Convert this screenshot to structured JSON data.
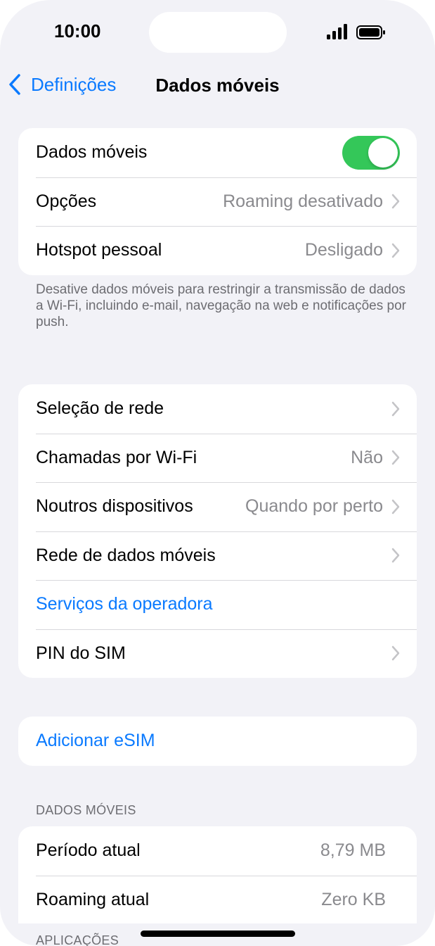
{
  "status_bar": {
    "time": "10:00"
  },
  "nav": {
    "back_label": "Definições",
    "title": "Dados móveis"
  },
  "group1": {
    "mobile_data_label": "Dados móveis",
    "mobile_data_on": true,
    "options_label": "Opções",
    "options_value": "Roaming desativado",
    "hotspot_label": "Hotspot pessoal",
    "hotspot_value": "Desligado"
  },
  "footnote": "Desative dados móveis para restringir a transmissão de dados a Wi-Fi, incluindo e-mail, navegação na web e notificações por push.",
  "group2": {
    "network_selection_label": "Seleção de rede",
    "wifi_calling_label": "Chamadas por Wi-Fi",
    "wifi_calling_value": "Não",
    "other_devices_label": "Noutros dispositivos",
    "other_devices_value": "Quando por perto",
    "cellular_network_label": "Rede de dados móveis",
    "carrier_services_label": "Serviços da operadora",
    "sim_pin_label": "PIN do SIM"
  },
  "group3": {
    "add_esim_label": "Adicionar eSIM"
  },
  "usage": {
    "header": "DADOS MÓVEIS",
    "current_period_label": "Período atual",
    "current_period_value": "8,79 MB",
    "current_roaming_label": "Roaming atual",
    "current_roaming_value": "Zero KB"
  },
  "apps_header": "APLICAÇÕES",
  "colors": {
    "accent": "#0a7aff",
    "toggle_on": "#34c759",
    "background": "#f2f2f7"
  }
}
